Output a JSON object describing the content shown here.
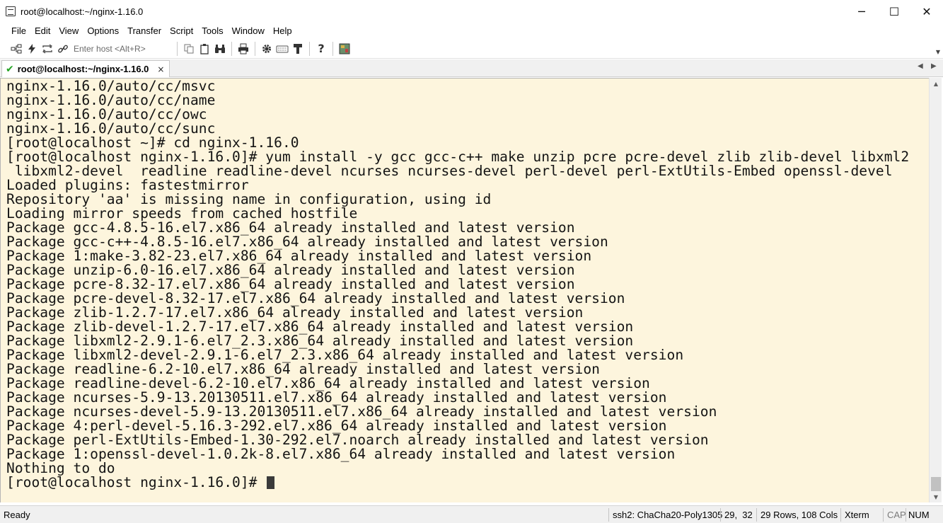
{
  "window": {
    "title": "root@localhost:~/nginx-1.16.0",
    "controls": {
      "minimize": "─",
      "maximize": "☐",
      "close": "✕"
    }
  },
  "menu": [
    "File",
    "Edit",
    "View",
    "Options",
    "Transfer",
    "Script",
    "Tools",
    "Window",
    "Help"
  ],
  "toolbar": {
    "host_placeholder": "Enter host <Alt+R>",
    "icons": [
      "connect-icon",
      "lightning-icon",
      "reconnect-icon",
      "link-icon",
      "copy-icon",
      "paste-icon",
      "find-icon",
      "print-icon",
      "settings-icon",
      "keymap-icon",
      "key-icon",
      "help-icon",
      "map-icon"
    ]
  },
  "tab": {
    "label": "root@localhost:~/nginx-1.16.0",
    "close": "×",
    "prev": "◀",
    "next": "▶"
  },
  "terminal": {
    "lines": [
      "nginx-1.16.0/auto/cc/msvc",
      "nginx-1.16.0/auto/cc/name",
      "nginx-1.16.0/auto/cc/owc",
      "nginx-1.16.0/auto/cc/sunc",
      "[root@localhost ~]# cd nginx-1.16.0",
      "[root@localhost nginx-1.16.0]# yum install -y gcc gcc-c++ make unzip pcre pcre-devel zlib zlib-devel libxml2",
      " libxml2-devel  readline readline-devel ncurses ncurses-devel perl-devel perl-ExtUtils-Embed openssl-devel",
      "Loaded plugins: fastestmirror",
      "Repository 'aa' is missing name in configuration, using id",
      "Loading mirror speeds from cached hostfile",
      "Package gcc-4.8.5-16.el7.x86_64 already installed and latest version",
      "Package gcc-c++-4.8.5-16.el7.x86_64 already installed and latest version",
      "Package 1:make-3.82-23.el7.x86_64 already installed and latest version",
      "Package unzip-6.0-16.el7.x86_64 already installed and latest version",
      "Package pcre-8.32-17.el7.x86_64 already installed and latest version",
      "Package pcre-devel-8.32-17.el7.x86_64 already installed and latest version",
      "Package zlib-1.2.7-17.el7.x86_64 already installed and latest version",
      "Package zlib-devel-1.2.7-17.el7.x86_64 already installed and latest version",
      "Package libxml2-2.9.1-6.el7_2.3.x86_64 already installed and latest version",
      "Package libxml2-devel-2.9.1-6.el7_2.3.x86_64 already installed and latest version",
      "Package readline-6.2-10.el7.x86_64 already installed and latest version",
      "Package readline-devel-6.2-10.el7.x86_64 already installed and latest version",
      "Package ncurses-5.9-13.20130511.el7.x86_64 already installed and latest version",
      "Package ncurses-devel-5.9-13.20130511.el7.x86_64 already installed and latest version",
      "Package 4:perl-devel-5.16.3-292.el7.x86_64 already installed and latest version",
      "Package perl-ExtUtils-Embed-1.30-292.el7.noarch already installed and latest version",
      "Package 1:openssl-devel-1.0.2k-8.el7.x86_64 already installed and latest version",
      "Nothing to do"
    ],
    "prompt": "[root@localhost nginx-1.16.0]# "
  },
  "status": {
    "ready": "Ready",
    "cipher": "ssh2: ChaCha20-Poly1305",
    "cursor_pos": "29,  32",
    "size": "29 Rows, 108 Cols",
    "terminal_type": "Xterm",
    "cap": "CAP",
    "num": "NUM"
  },
  "colors": {
    "terminal_bg": "#fdf5dd",
    "terminal_fg": "#141414",
    "tab_check": "#23a323"
  }
}
